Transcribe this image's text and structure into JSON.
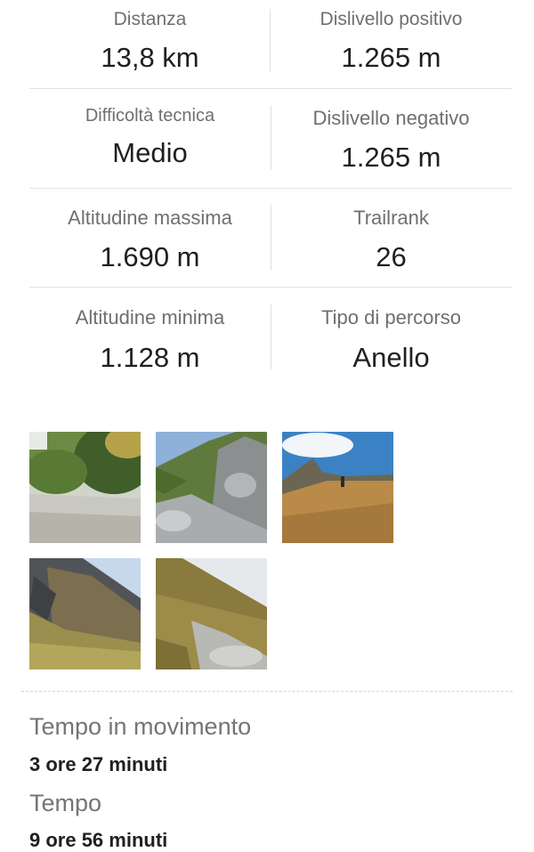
{
  "stats": [
    {
      "label": "Distanza",
      "value": "13,8 km"
    },
    {
      "label": "Dislivello positivo",
      "value": "1.265 m"
    },
    {
      "label": "Difficoltà tecnica",
      "value": "Medio"
    },
    {
      "label": "Dislivello negativo",
      "value": "1.265 m"
    },
    {
      "label": "Altitudine massima",
      "value": "1.690 m"
    },
    {
      "label": "Trailrank",
      "value": "26"
    },
    {
      "label": "Altitudine minima",
      "value": "1.128 m"
    },
    {
      "label": "Tipo di percorso",
      "value": "Anello"
    }
  ],
  "times": [
    {
      "label": "Tempo in movimento",
      "value": "3 ore 27 minuti"
    },
    {
      "label": "Tempo",
      "value": "9 ore 56 minuti"
    }
  ]
}
